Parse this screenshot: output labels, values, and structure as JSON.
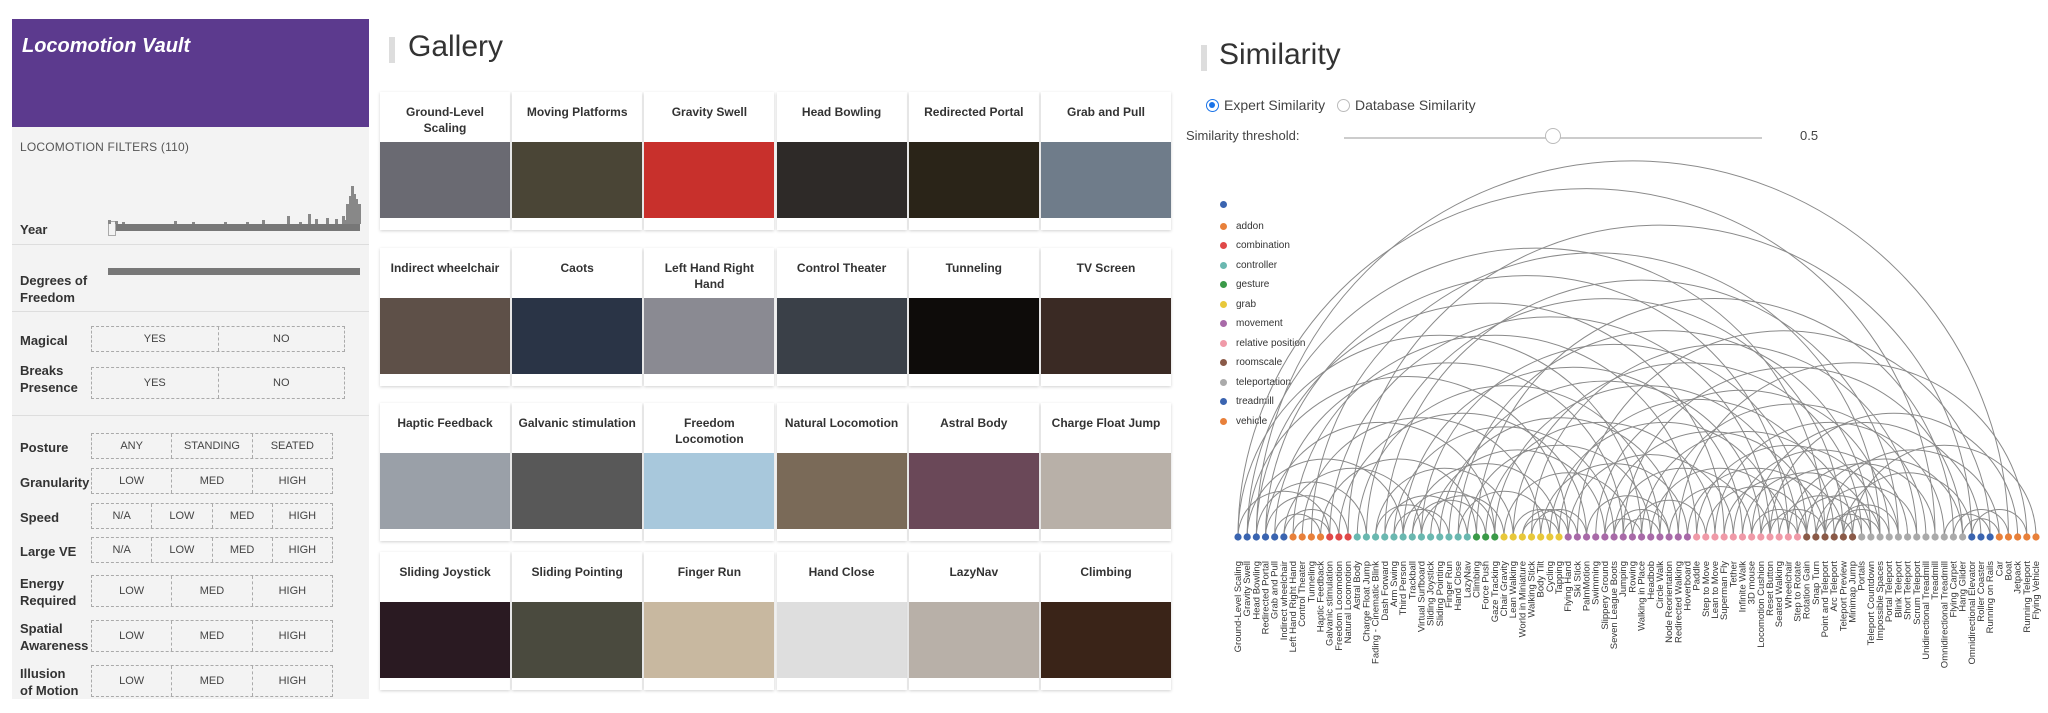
{
  "sidebar": {
    "app_title": "Locomotion Vault",
    "filters_header": "LOCOMOTION FILTERS (110)",
    "year_label": "Year",
    "dof_label": "Degrees of Freedom",
    "magical": {
      "label": "Magical",
      "options": [
        "YES",
        "NO"
      ]
    },
    "breaks_presence": {
      "label": "Breaks Presence",
      "options": [
        "YES",
        "NO"
      ]
    },
    "posture": {
      "label": "Posture",
      "options": [
        "ANY",
        "STANDING",
        "SEATED"
      ]
    },
    "granularity": {
      "label": "Granularity",
      "options": [
        "LOW",
        "MED",
        "HIGH"
      ]
    },
    "speed": {
      "label": "Speed",
      "options": [
        "N/A",
        "LOW",
        "MED",
        "HIGH"
      ]
    },
    "large_ve": {
      "label": "Large VE",
      "options": [
        "N/A",
        "LOW",
        "MED",
        "HIGH"
      ]
    },
    "energy": {
      "label": "Energy Required",
      "options": [
        "LOW",
        "MED",
        "HIGH"
      ]
    },
    "spatial": {
      "label": "Spatial Awareness",
      "options": [
        "LOW",
        "MED",
        "HIGH"
      ]
    },
    "illusion": {
      "label": "Illusion of Motion",
      "options": [
        "LOW",
        "MED",
        "HIGH"
      ]
    }
  },
  "gallery": {
    "title": "Gallery",
    "cards": [
      "Ground-Level Scaling",
      "Moving Platforms",
      "Gravity Swell",
      "Head Bowling",
      "Redirected Portal",
      "Grab and Pull",
      "Indirect wheelchair",
      "Caots",
      "Left Hand Right Hand",
      "Control Theater",
      "Tunneling",
      "TV Screen",
      "Haptic Feedback",
      "Galvanic stimulation",
      "Freedom Locomotion",
      "Natural Locomotion",
      "Astral Body",
      "Charge Float Jump",
      "Sliding Joystick",
      "Sliding Pointing",
      "Finger Run",
      "Hand Close",
      "LazyNav",
      "Climbing"
    ],
    "thumb_colors": [
      "#6a6a72",
      "#4a4536",
      "#c8302c",
      "#2e2a28",
      "#2a2418",
      "#6f7c8a",
      "#5e5048",
      "#2a3446",
      "#8a8a92",
      "#3a4048",
      "#0e0c0a",
      "#3a2a24",
      "#9aa0a8",
      "#585858",
      "#a8c8dc",
      "#7a6a58",
      "#6a4858",
      "#b8b0a8",
      "#2a1a22",
      "#4a4a3e",
      "#c8b8a0",
      "#dedede",
      "#b8b0a8",
      "#3a2418"
    ]
  },
  "similarity": {
    "title": "Similarity",
    "radio_expert": "Expert Similarity",
    "radio_database": "Database Similarity",
    "threshold_label": "Similarity threshold:",
    "threshold_value": "0.5",
    "threshold_numeric": 0.5,
    "legend": [
      {
        "name": "",
        "color": "#3a64b0"
      },
      {
        "name": "addon",
        "color": "#e8803a"
      },
      {
        "name": "combination",
        "color": "#e04848"
      },
      {
        "name": "controller",
        "color": "#6ab8b0"
      },
      {
        "name": "gesture",
        "color": "#3a9a48"
      },
      {
        "name": "grab",
        "color": "#e8c83a"
      },
      {
        "name": "movement",
        "color": "#a86aa8"
      },
      {
        "name": "relative position",
        "color": "#f09aa8"
      },
      {
        "name": "roomscale",
        "color": "#8a5a48"
      },
      {
        "name": "teleportation",
        "color": "#aaaaaa"
      },
      {
        "name": "treadmill",
        "color": "#3a64b0"
      },
      {
        "name": "vehicle",
        "color": "#e8803a"
      }
    ],
    "node_labels": [
      "Ground-Level Scaling",
      "Gravity Swell",
      "Head Bowling",
      "Redirected Portal",
      "Grab and Pull",
      "Indirect wheelchair",
      "Left Hand Right Hand",
      "Control Theater",
      "Tunneling",
      "Haptic Feedback",
      "Galvanic stimulation",
      "Freedom Locomotion",
      "Natural Locomotion",
      "Astral Body",
      "Charge Float Jump",
      "Fading - Cinematic Blink",
      "Dash Forward",
      "Arm Swing",
      "Third Person",
      "Trackball",
      "Virtual Surfboard",
      "Sliding Joystick",
      "Sliding Pointing",
      "Finger Run",
      "Hand Close",
      "LazyNav",
      "Climbing",
      "Force Push",
      "Gaze Tracking",
      "Chair Gravity",
      "Lean Walking",
      "World in Miniature",
      "Walking Stick",
      "Body Tilt",
      "Cycling",
      "Tapping",
      "Flying Hand",
      "Ski Stick",
      "PalmMotion",
      "Swimming",
      "Slippery Ground",
      "Seven League Boots",
      "Jumping",
      "Rowing",
      "Walking in Place",
      "Headbob",
      "Circle Walk",
      "Node Reorientation",
      "Redirected Walking",
      "Hoverboard",
      "Paddle",
      "Step to Move",
      "Lean to Move",
      "Superman Fly",
      "Tether",
      "Infinite Walk",
      "3D mouse",
      "Locomotion Cushion",
      "Reset Button",
      "Seated Walking",
      "Wheelchair",
      "Step to Rotate",
      "Rotation Gain",
      "Snap Turn",
      "Point and Teleport",
      "Arc Teleport",
      "Teleport Preview",
      "Minimap Jump",
      "Portals",
      "Teleport Countdown",
      "Impossible Spaces",
      "Portal Teleport",
      "Blink Teleport",
      "Short Teleport",
      "Scrum Teleport",
      "Unidirectional Treadmill",
      "Treadmill",
      "Omnidirectional Treadmill",
      "Flying Carpet",
      "Hang Glider",
      "Omnidirectional Elevator",
      "Roller Coaster",
      "Running on Rails",
      "Car",
      "Boat",
      "Jetpack",
      "Running Teleport",
      "Flying Vehicle"
    ]
  }
}
